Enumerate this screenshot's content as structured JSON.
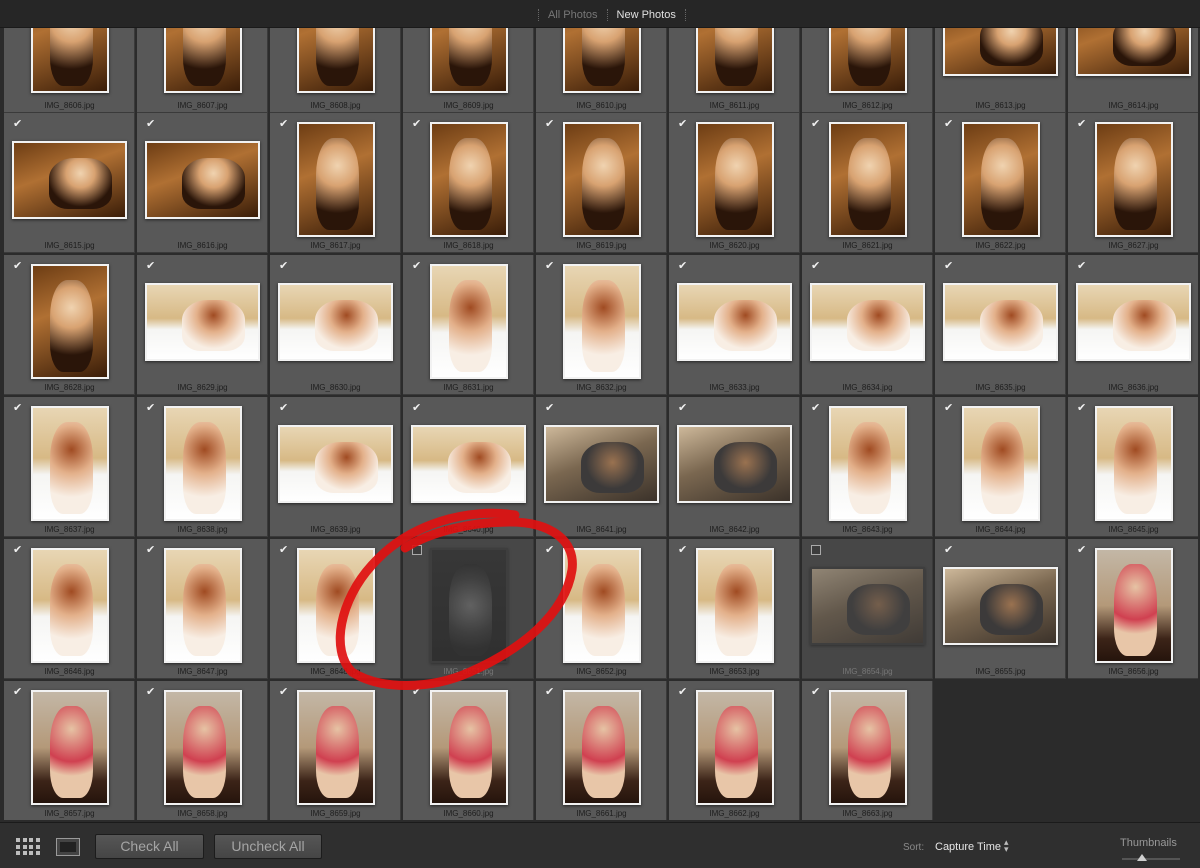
{
  "tabs": [
    {
      "label": "All Photos",
      "active": false
    },
    {
      "label": "New Photos",
      "active": true
    }
  ],
  "photos": [
    {
      "file": "IMG_8606.jpg",
      "checked": null,
      "orientation": "portrait",
      "tone": "warm"
    },
    {
      "file": "IMG_8607.jpg",
      "checked": null,
      "orientation": "portrait",
      "tone": "warm"
    },
    {
      "file": "IMG_8608.jpg",
      "checked": null,
      "orientation": "portrait",
      "tone": "warm"
    },
    {
      "file": "IMG_8609.jpg",
      "checked": null,
      "orientation": "portrait",
      "tone": "warm"
    },
    {
      "file": "IMG_8610.jpg",
      "checked": null,
      "orientation": "portrait",
      "tone": "warm"
    },
    {
      "file": "IMG_8611.jpg",
      "checked": null,
      "orientation": "portrait",
      "tone": "warm"
    },
    {
      "file": "IMG_8612.jpg",
      "checked": null,
      "orientation": "portrait",
      "tone": "warm"
    },
    {
      "file": "IMG_8613.jpg",
      "checked": null,
      "orientation": "landscape",
      "tone": "warm"
    },
    {
      "file": "IMG_8614.jpg",
      "checked": null,
      "orientation": "landscape",
      "tone": "warm"
    },
    {
      "file": "IMG_8615.jpg",
      "checked": true,
      "orientation": "landscape",
      "tone": "warm"
    },
    {
      "file": "IMG_8616.jpg",
      "checked": true,
      "orientation": "landscape",
      "tone": "warm"
    },
    {
      "file": "IMG_8617.jpg",
      "checked": true,
      "orientation": "portrait",
      "tone": "warm"
    },
    {
      "file": "IMG_8618.jpg",
      "checked": true,
      "orientation": "portrait",
      "tone": "warm"
    },
    {
      "file": "IMG_8619.jpg",
      "checked": true,
      "orientation": "portrait",
      "tone": "warm"
    },
    {
      "file": "IMG_8620.jpg",
      "checked": true,
      "orientation": "portrait",
      "tone": "warm"
    },
    {
      "file": "IMG_8621.jpg",
      "checked": true,
      "orientation": "portrait",
      "tone": "warm"
    },
    {
      "file": "IMG_8622.jpg",
      "checked": true,
      "orientation": "portrait",
      "tone": "warm"
    },
    {
      "file": "IMG_8627.jpg",
      "checked": true,
      "orientation": "portrait",
      "tone": "warm"
    },
    {
      "file": "IMG_8628.jpg",
      "checked": true,
      "orientation": "portrait",
      "tone": "warm"
    },
    {
      "file": "IMG_8629.jpg",
      "checked": true,
      "orientation": "landscape",
      "tone": "bright"
    },
    {
      "file": "IMG_8630.jpg",
      "checked": true,
      "orientation": "landscape",
      "tone": "bright"
    },
    {
      "file": "IMG_8631.jpg",
      "checked": true,
      "orientation": "portrait",
      "tone": "bright"
    },
    {
      "file": "IMG_8632.jpg",
      "checked": true,
      "orientation": "portrait",
      "tone": "bright"
    },
    {
      "file": "IMG_8633.jpg",
      "checked": true,
      "orientation": "landscape",
      "tone": "bright"
    },
    {
      "file": "IMG_8634.jpg",
      "checked": true,
      "orientation": "landscape",
      "tone": "bright"
    },
    {
      "file": "IMG_8635.jpg",
      "checked": true,
      "orientation": "landscape",
      "tone": "bright"
    },
    {
      "file": "IMG_8636.jpg",
      "checked": true,
      "orientation": "landscape",
      "tone": "bright"
    },
    {
      "file": "IMG_8637.jpg",
      "checked": true,
      "orientation": "portrait",
      "tone": "bright"
    },
    {
      "file": "IMG_8638.jpg",
      "checked": true,
      "orientation": "portrait",
      "tone": "bright"
    },
    {
      "file": "IMG_8639.jpg",
      "checked": true,
      "orientation": "landscape",
      "tone": "bright"
    },
    {
      "file": "IMG_8640.jpg",
      "checked": true,
      "orientation": "landscape",
      "tone": "bright"
    },
    {
      "file": "IMG_8641.jpg",
      "checked": true,
      "orientation": "landscape",
      "tone": "shoot"
    },
    {
      "file": "IMG_8642.jpg",
      "checked": true,
      "orientation": "landscape",
      "tone": "shoot"
    },
    {
      "file": "IMG_8643.jpg",
      "checked": true,
      "orientation": "portrait",
      "tone": "bright"
    },
    {
      "file": "IMG_8644.jpg",
      "checked": true,
      "orientation": "portrait",
      "tone": "bright"
    },
    {
      "file": "IMG_8645.jpg",
      "checked": true,
      "orientation": "portrait",
      "tone": "bright"
    },
    {
      "file": "IMG_8646.jpg",
      "checked": true,
      "orientation": "portrait",
      "tone": "bright"
    },
    {
      "file": "IMG_8647.jpg",
      "checked": true,
      "orientation": "portrait",
      "tone": "bright"
    },
    {
      "file": "IMG_8648.jpg",
      "checked": true,
      "orientation": "portrait",
      "tone": "bright"
    },
    {
      "file": "IMG_8651.jpg",
      "checked": false,
      "orientation": "portrait",
      "tone": "dark"
    },
    {
      "file": "IMG_8652.jpg",
      "checked": true,
      "orientation": "portrait",
      "tone": "bright"
    },
    {
      "file": "IMG_8653.jpg",
      "checked": true,
      "orientation": "portrait",
      "tone": "bright"
    },
    {
      "file": "IMG_8654.jpg",
      "checked": false,
      "orientation": "landscape",
      "tone": "shoot"
    },
    {
      "file": "IMG_8655.jpg",
      "checked": true,
      "orientation": "landscape",
      "tone": "shoot"
    },
    {
      "file": "IMG_8656.jpg",
      "checked": true,
      "orientation": "portrait",
      "tone": "red"
    },
    {
      "file": "IMG_8657.jpg",
      "checked": true,
      "orientation": "portrait",
      "tone": "red"
    },
    {
      "file": "IMG_8658.jpg",
      "checked": true,
      "orientation": "portrait",
      "tone": "red"
    },
    {
      "file": "IMG_8659.jpg",
      "checked": true,
      "orientation": "portrait",
      "tone": "red"
    },
    {
      "file": "IMG_8660.jpg",
      "checked": true,
      "orientation": "portrait",
      "tone": "red"
    },
    {
      "file": "IMG_8661.jpg",
      "checked": true,
      "orientation": "portrait",
      "tone": "red"
    },
    {
      "file": "IMG_8662.jpg",
      "checked": true,
      "orientation": "portrait",
      "tone": "red"
    },
    {
      "file": "IMG_8663.jpg",
      "checked": true,
      "orientation": "portrait",
      "tone": "red"
    }
  ],
  "toolbar": {
    "check_all_label": "Check All",
    "uncheck_all_label": "Uncheck All",
    "grid_view_icon": "grid-view-icon",
    "loupe_view_icon": "loupe-view-icon",
    "sort_label": "Sort:",
    "sort_value": "Capture Time",
    "thumbnails_label": "Thumbnails",
    "thumbnail_size_fraction": 0.35
  },
  "annotation": {
    "shape": "hand-drawn circle",
    "color": "#e01010",
    "target": "IMG_8651.jpg"
  },
  "colors": {
    "cell": "#585858",
    "cell_excluded": "#474747",
    "background": "#2b2b2b",
    "toolbar": "#2f2f2f"
  }
}
